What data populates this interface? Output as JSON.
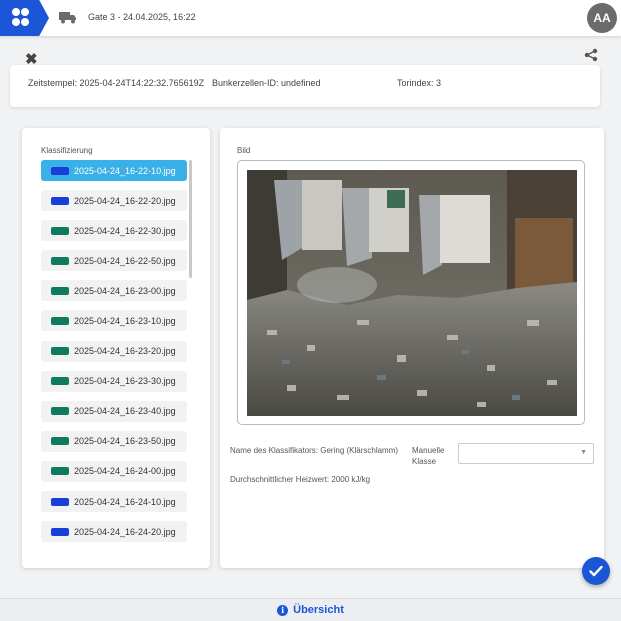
{
  "header": {
    "title": "Gate 3 - 24.04.2025, 16:22",
    "avatar_initials": "AA",
    "logo_icon": "hexagon-logo-icon",
    "truck_icon": "truck-icon"
  },
  "actions": {
    "close_icon": "close-icon",
    "share_icon": "share-icon"
  },
  "info": {
    "timestamp": "Zeitstempel: 2025-04-24T14:22:32.765619Z",
    "bunker_cell": "Bunkerzellen-ID: undefined",
    "gate_index": "Torindex: 3"
  },
  "classification": {
    "label": "Klassifizierung",
    "files": [
      {
        "name": "2025-04-24_16-22-10.jpg",
        "color": "#1a3fd8",
        "selected": true
      },
      {
        "name": "2025-04-24_16-22-20.jpg",
        "color": "#1a3fd8",
        "selected": false
      },
      {
        "name": "2025-04-24_16-22-30.jpg",
        "color": "#0f7a5f",
        "selected": false
      },
      {
        "name": "2025-04-24_16-22-50.jpg",
        "color": "#0f7a5f",
        "selected": false
      },
      {
        "name": "2025-04-24_16-23-00.jpg",
        "color": "#0f7a5f",
        "selected": false
      },
      {
        "name": "2025-04-24_16-23-10.jpg",
        "color": "#0f7a5f",
        "selected": false
      },
      {
        "name": "2025-04-24_16-23-20.jpg",
        "color": "#0f7a5f",
        "selected": false
      },
      {
        "name": "2025-04-24_16-23-30.jpg",
        "color": "#0f7a5f",
        "selected": false
      },
      {
        "name": "2025-04-24_16-23-40.jpg",
        "color": "#0f7a5f",
        "selected": false
      },
      {
        "name": "2025-04-24_16-23-50.jpg",
        "color": "#0f7a5f",
        "selected": false
      },
      {
        "name": "2025-04-24_16-24-00.jpg",
        "color": "#0f7a5f",
        "selected": false
      },
      {
        "name": "2025-04-24_16-24-10.jpg",
        "color": "#1a3fd8",
        "selected": false
      },
      {
        "name": "2025-04-24_16-24-20.jpg",
        "color": "#1a3fd8",
        "selected": false
      }
    ]
  },
  "image_panel": {
    "label": "Bild",
    "classifier_name": "Name des Klassifikators: Gering (Klärschlamm)",
    "heating_value": "Durchschnittlicher Heizwert: 2000 kJ/kg",
    "manual_class_label": "Manuelle Klasse",
    "manual_class_value": ""
  },
  "fab": {
    "icon": "checkmark-icon",
    "color": "#1a56d6"
  },
  "footer": {
    "label": "Übersicht",
    "icon": "info-icon"
  },
  "colors": {
    "primary": "#1a56d6",
    "selected": "#39b1e8"
  }
}
